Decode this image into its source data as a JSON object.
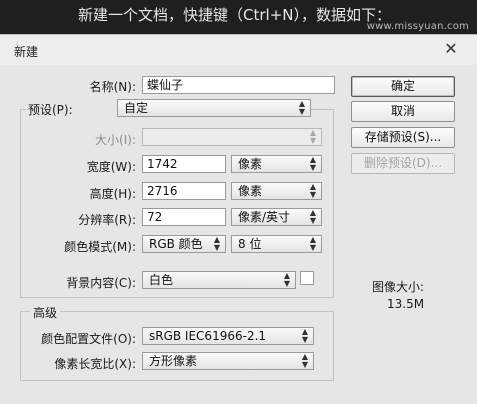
{
  "caption": {
    "text": "新建一个文档，快捷键（Ctrl+N），数据如下：",
    "watermark": "www.missyuan.com"
  },
  "dialog": {
    "title": "新建",
    "close_glyph": "✕"
  },
  "form": {
    "name_label": "名称(N):",
    "name_value": "蝶仙子",
    "preset_label": "预设(P):",
    "preset_value": "自定",
    "size_label": "大小(I):",
    "size_value": "",
    "width_label": "宽度(W):",
    "width_value": "1742",
    "width_unit": "像素",
    "height_label": "高度(H):",
    "height_value": "2716",
    "height_unit": "像素",
    "resolution_label": "分辨率(R):",
    "resolution_value": "72",
    "resolution_unit": "像素/英寸",
    "color_mode_label": "颜色模式(M):",
    "color_mode_value": "RGB 颜色",
    "bit_depth_value": "8 位",
    "background_label": "背景内容(C):",
    "background_value": "白色",
    "background_swatch_color": "#ffffff"
  },
  "advanced": {
    "legend": "高级",
    "profile_label": "颜色配置文件(O):",
    "profile_value": "sRGB IEC61966-2.1",
    "aspect_label": "像素长宽比(X):",
    "aspect_value": "方形像素"
  },
  "buttons": {
    "ok": "确定",
    "cancel": "取消",
    "save_preset": "存储预设(S)...",
    "delete_preset": "删除预设(D)..."
  },
  "image_size": {
    "label": "图像大小:",
    "value": "13.5M"
  },
  "icons": {
    "select_arrow_up": "▲",
    "select_arrow_down": "▼"
  }
}
